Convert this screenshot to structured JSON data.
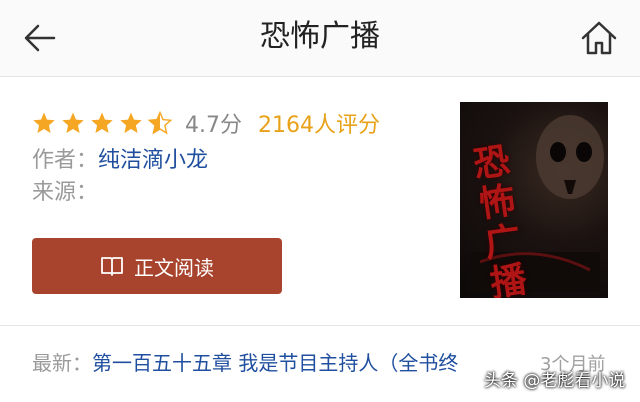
{
  "header": {
    "title": "恐怖广播"
  },
  "rating": {
    "stars": 4.5,
    "score": "4.7分",
    "reviews": "2164人评分"
  },
  "meta": {
    "author_label": "作者：",
    "author": "纯洁滴小龙",
    "source_label": "来源："
  },
  "read_button": {
    "label": "正文阅读"
  },
  "cover": {
    "title_text": "恐怖广播"
  },
  "latest": {
    "label": "最新：",
    "chapter": "第一百五十五章 我是节目主持人（全书终",
    "time": "3个月前"
  },
  "watermark": "头条 @老彪看小说",
  "colors": {
    "accent": "#a8432d",
    "link": "#1f4f9e",
    "star": "#f5a623",
    "reviews": "#e8a21a"
  }
}
